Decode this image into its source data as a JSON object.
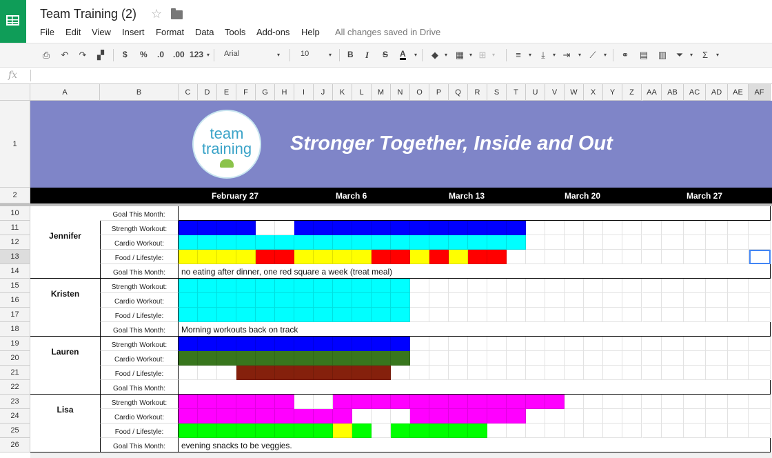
{
  "app": {
    "title": "Team Training (2)",
    "save_status": "All changes saved in Drive",
    "menu": [
      "File",
      "Edit",
      "View",
      "Insert",
      "Format",
      "Data",
      "Tools",
      "Add-ons",
      "Help"
    ]
  },
  "toolbar": {
    "currency": "$",
    "percent": "%",
    "dec_decrease": ".0",
    "dec_increase": ".00",
    "number_format": "123",
    "font": "Arial",
    "font_size": "10",
    "bold": "B",
    "italic": "I",
    "strike": "S",
    "text_color": "A"
  },
  "formula_bar": {
    "icon": "fx",
    "value": ""
  },
  "columns": [
    "A",
    "B",
    "C",
    "D",
    "E",
    "F",
    "G",
    "H",
    "I",
    "J",
    "K",
    "L",
    "M",
    "N",
    "O",
    "P",
    "Q",
    "R",
    "S",
    "T",
    "U",
    "V",
    "W",
    "X",
    "Y",
    "Z",
    "AA",
    "AB",
    "AC",
    "AD",
    "AE",
    "AF"
  ],
  "banner": {
    "title": "Stronger Together, Inside and Out",
    "logo_line1": "team",
    "logo_line2": "training",
    "color": "#7f85c8"
  },
  "dates": [
    "February 27",
    "March 6",
    "March 13",
    "March 20",
    "March 27"
  ],
  "goal_row": {
    "row": "10",
    "label": "Goal This Month:"
  },
  "labels": {
    "strength": "Strength Workout:",
    "cardio": "Cardio Workout:",
    "food": "Food / Lifestyle:",
    "goal": "Goal This Month:"
  },
  "colors": {
    "blue": "#0000ff",
    "cyan": "#00ffff",
    "yellow": "#ffff00",
    "red": "#ff0000",
    "green_dark": "#38761d",
    "brown": "#85200c",
    "magenta": "#ff00ff",
    "green": "#00ff00",
    "selection": "#4285f4"
  },
  "people": [
    {
      "name": "Jennifer",
      "rows": [
        "11",
        "12",
        "13",
        "14"
      ],
      "strength": [
        "blue",
        "blue",
        "blue",
        "blue",
        "",
        "",
        "blue",
        "blue",
        "blue",
        "blue",
        "blue",
        "blue",
        "blue",
        "blue",
        "blue",
        "blue",
        "blue",
        "blue"
      ],
      "cardio": [
        "cyan",
        "cyan",
        "cyan",
        "cyan",
        "cyan",
        "cyan",
        "cyan",
        "cyan",
        "cyan",
        "cyan",
        "cyan",
        "cyan",
        "cyan",
        "cyan",
        "cyan",
        "cyan",
        "cyan",
        "cyan"
      ],
      "food": [
        "yellow",
        "yellow",
        "yellow",
        "yellow",
        "red",
        "red",
        "yellow",
        "yellow",
        "yellow",
        "yellow",
        "red",
        "red",
        "yellow",
        "red",
        "yellow",
        "red",
        "red",
        ""
      ],
      "goal": "no eating after dinner, one red square a week (treat meal)"
    },
    {
      "name": "Kristen",
      "rows": [
        "15",
        "16",
        "17",
        "18"
      ],
      "strength": [
        "cyan",
        "cyan",
        "cyan",
        "cyan",
        "cyan",
        "cyan",
        "cyan",
        "cyan",
        "cyan",
        "cyan",
        "cyan",
        "cyan"
      ],
      "cardio": [
        "cyan",
        "cyan",
        "cyan",
        "cyan",
        "cyan",
        "cyan",
        "cyan",
        "cyan",
        "cyan",
        "cyan",
        "cyan",
        "cyan"
      ],
      "food": [
        "cyan",
        "cyan",
        "cyan",
        "cyan",
        "cyan",
        "cyan",
        "cyan",
        "cyan",
        "cyan",
        "cyan",
        "cyan",
        "cyan"
      ],
      "goal": "Morning workouts back on track"
    },
    {
      "name": "Lauren",
      "rows": [
        "19",
        "20",
        "21",
        "22"
      ],
      "strength": [
        "blue",
        "blue",
        "blue",
        "blue",
        "blue",
        "blue",
        "blue",
        "blue",
        "blue",
        "blue",
        "blue",
        "blue"
      ],
      "cardio": [
        "green_dark",
        "green_dark",
        "green_dark",
        "green_dark",
        "green_dark",
        "green_dark",
        "green_dark",
        "green_dark",
        "green_dark",
        "green_dark",
        "green_dark",
        "green_dark"
      ],
      "food": [
        "",
        "",
        "",
        "brown",
        "brown",
        "brown",
        "brown",
        "brown",
        "brown",
        "brown",
        "brown",
        ""
      ],
      "goal": ""
    },
    {
      "name": "Lisa",
      "rows": [
        "23",
        "24",
        "25",
        "26"
      ],
      "strength": [
        "magenta",
        "magenta",
        "magenta",
        "magenta",
        "magenta",
        "magenta",
        "",
        "",
        "magenta",
        "magenta",
        "magenta",
        "magenta",
        "magenta",
        "magenta",
        "magenta",
        "magenta",
        "magenta",
        "magenta",
        "magenta",
        "magenta"
      ],
      "cardio": [
        "magenta",
        "magenta",
        "magenta",
        "magenta",
        "magenta",
        "magenta",
        "magenta",
        "magenta",
        "magenta",
        "",
        "",
        "",
        "magenta",
        "magenta",
        "magenta",
        "magenta",
        "magenta",
        "magenta"
      ],
      "food": [
        "green",
        "green",
        "green",
        "green",
        "green",
        "green",
        "green",
        "green",
        "yellow",
        "green",
        "",
        "green",
        "green",
        "green",
        "green",
        "green"
      ],
      "goal": "evening snacks to be veggies."
    }
  ],
  "row_numbers": [
    "1",
    "2",
    "10",
    "11",
    "12",
    "13",
    "14",
    "15",
    "16",
    "17",
    "18",
    "19",
    "20",
    "21",
    "22",
    "23",
    "24",
    "25",
    "26"
  ]
}
